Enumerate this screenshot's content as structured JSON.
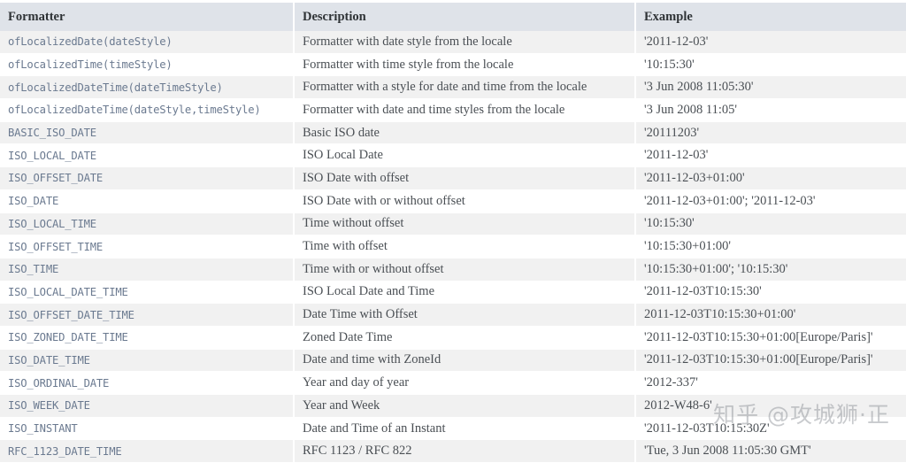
{
  "table": {
    "columns": [
      "Formatter",
      "Description",
      "Example"
    ],
    "rows": [
      {
        "formatter": "ofLocalizedDate(dateStyle)",
        "description": "Formatter with date style from the locale",
        "example": "'2011-12-03'"
      },
      {
        "formatter": "ofLocalizedTime(timeStyle)",
        "description": "Formatter with time style from the locale",
        "example": "'10:15:30'"
      },
      {
        "formatter": "ofLocalizedDateTime(dateTimeStyle)",
        "description": "Formatter with a style for date and time from the locale",
        "example": "'3 Jun 2008 11:05:30'"
      },
      {
        "formatter": "ofLocalizedDateTime(dateStyle,timeStyle)",
        "description": "Formatter with date and time styles from the locale",
        "example": "'3 Jun 2008 11:05'"
      },
      {
        "formatter": "BASIC_ISO_DATE",
        "description": "Basic ISO date",
        "example": "'20111203'"
      },
      {
        "formatter": "ISO_LOCAL_DATE",
        "description": "ISO Local Date",
        "example": "'2011-12-03'"
      },
      {
        "formatter": "ISO_OFFSET_DATE",
        "description": "ISO Date with offset",
        "example": "'2011-12-03+01:00'"
      },
      {
        "formatter": "ISO_DATE",
        "description": "ISO Date with or without offset",
        "example": "'2011-12-03+01:00'; '2011-12-03'"
      },
      {
        "formatter": "ISO_LOCAL_TIME",
        "description": "Time without offset",
        "example": "'10:15:30'"
      },
      {
        "formatter": "ISO_OFFSET_TIME",
        "description": "Time with offset",
        "example": "'10:15:30+01:00'"
      },
      {
        "formatter": "ISO_TIME",
        "description": "Time with or without offset",
        "example": "'10:15:30+01:00'; '10:15:30'"
      },
      {
        "formatter": "ISO_LOCAL_DATE_TIME",
        "description": "ISO Local Date and Time",
        "example": "'2011-12-03T10:15:30'"
      },
      {
        "formatter": "ISO_OFFSET_DATE_TIME",
        "description": "Date Time with Offset",
        "example": "2011-12-03T10:15:30+01:00'"
      },
      {
        "formatter": "ISO_ZONED_DATE_TIME",
        "description": "Zoned Date Time",
        "example": "'2011-12-03T10:15:30+01:00[Europe/Paris]'"
      },
      {
        "formatter": "ISO_DATE_TIME",
        "description": "Date and time with ZoneId",
        "example": "'2011-12-03T10:15:30+01:00[Europe/Paris]'"
      },
      {
        "formatter": "ISO_ORDINAL_DATE",
        "description": "Year and day of year",
        "example": "'2012-337'"
      },
      {
        "formatter": "ISO_WEEK_DATE",
        "description": "Year and Week",
        "example": "2012-W48-6'"
      },
      {
        "formatter": "ISO_INSTANT",
        "description": "Date and Time of an Instant",
        "example": "'2011-12-03T10:15:30Z'"
      },
      {
        "formatter": "RFC_1123_DATE_TIME",
        "description": "RFC 1123 / RFC 822",
        "example": "'Tue, 3 Jun 2008 11:05:30 GMT'"
      }
    ]
  },
  "watermark": {
    "text": "知乎 @攻城狮·正"
  }
}
